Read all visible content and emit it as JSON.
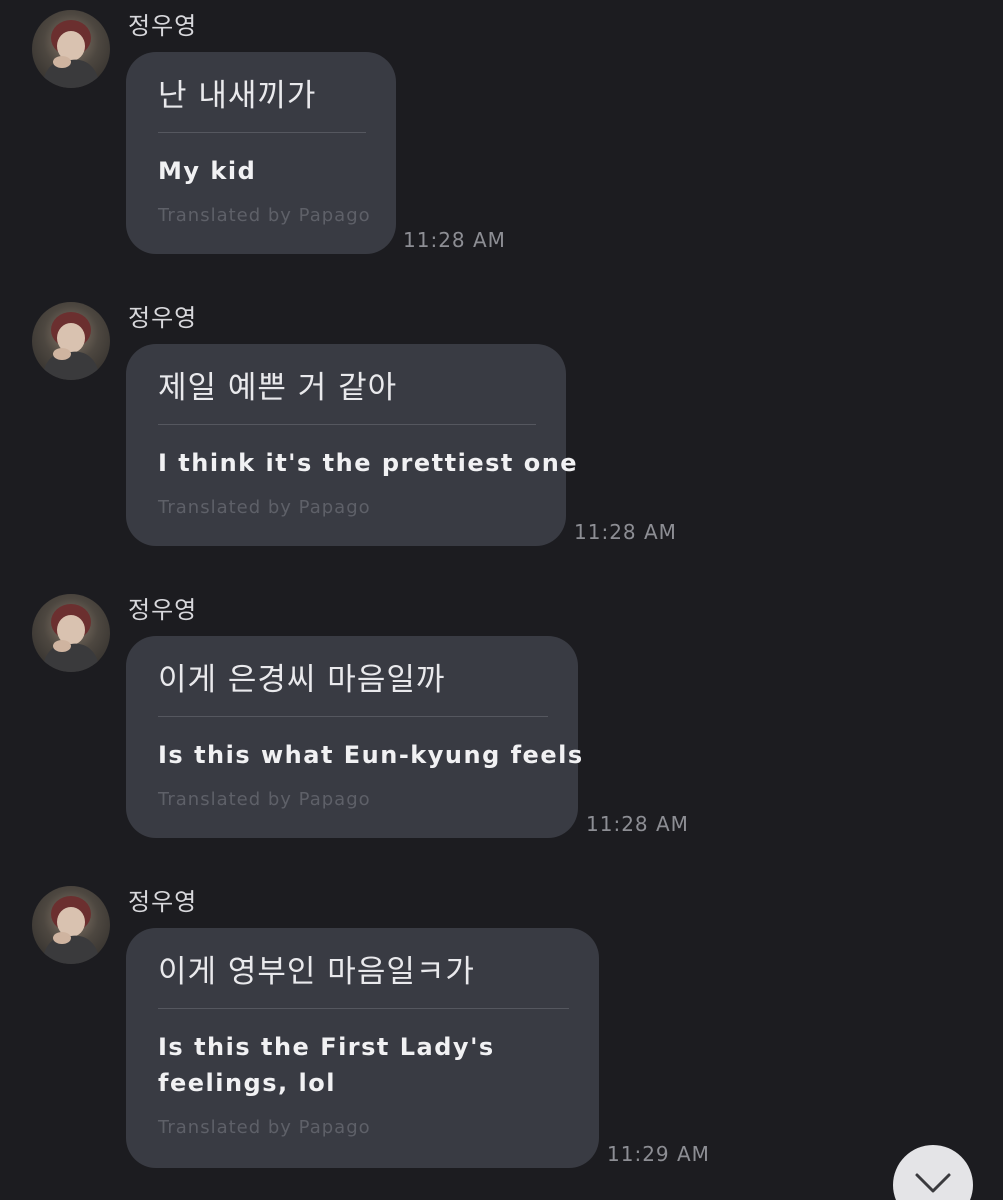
{
  "messages": [
    {
      "sender": "정우영",
      "original": "난 내새끼가",
      "translated": "My kid",
      "credit": "Translated by Papago",
      "time": "11:28 AM"
    },
    {
      "sender": "정우영",
      "original": "제일 예쁜 거 같아",
      "translated": "I think it's the prettiest one",
      "credit": "Translated by Papago",
      "time": "11:28 AM"
    },
    {
      "sender": "정우영",
      "original": "이게 은경씨 마음일까",
      "translated": "Is this what Eun-kyung feels",
      "credit": "Translated by Papago",
      "time": "11:28 AM"
    },
    {
      "sender": "정우영",
      "original": "이게 영부인 마음일ㅋ가",
      "translated_line1": "Is this the First Lady's",
      "translated_line2": "feelings, lol",
      "credit": "Translated by Papago",
      "time": "11:29 AM"
    }
  ],
  "icons": {
    "avatar": "profile-photo",
    "scroll_down": "chevron-down-icon"
  }
}
